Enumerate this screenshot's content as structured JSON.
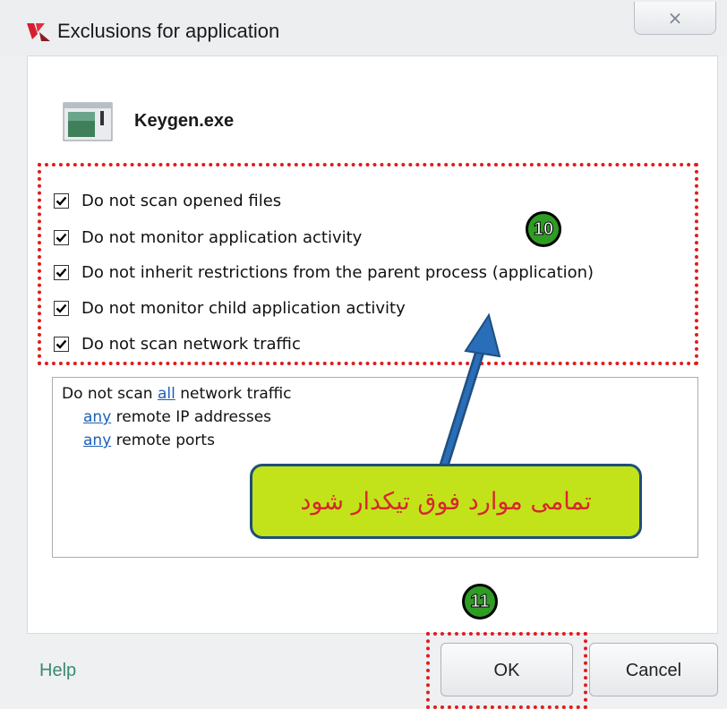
{
  "window": {
    "title": "Exclusions for application",
    "close_label": "×"
  },
  "app": {
    "name": "Keygen.exe"
  },
  "options": [
    {
      "label": "Do not scan opened files",
      "checked": true
    },
    {
      "label": "Do not monitor application activity",
      "checked": true
    },
    {
      "label": "Do not inherit restrictions from the parent process (application)",
      "checked": true
    },
    {
      "label": "Do not monitor child application activity",
      "checked": true
    },
    {
      "label": "Do not scan network traffic",
      "checked": true
    }
  ],
  "details": {
    "line1_prefix": "Do not scan ",
    "line1_link": "all",
    "line1_suffix": " network traffic",
    "line2_link": "any",
    "line2_suffix": " remote IP addresses",
    "line3_link": "any",
    "line3_suffix": " remote ports"
  },
  "annotations": {
    "step10": "10",
    "step11": "11",
    "callout": "تمامی موارد فوق تیکدار شود"
  },
  "footer": {
    "help": "Help",
    "ok": "OK",
    "cancel": "Cancel"
  },
  "colors": {
    "accent_link": "#1c5fb8",
    "annotation_red": "#e21b1b",
    "callout_bg": "#c2e31a",
    "badge_green": "#2f9c25",
    "arrow_blue": "#1f5fa8"
  }
}
